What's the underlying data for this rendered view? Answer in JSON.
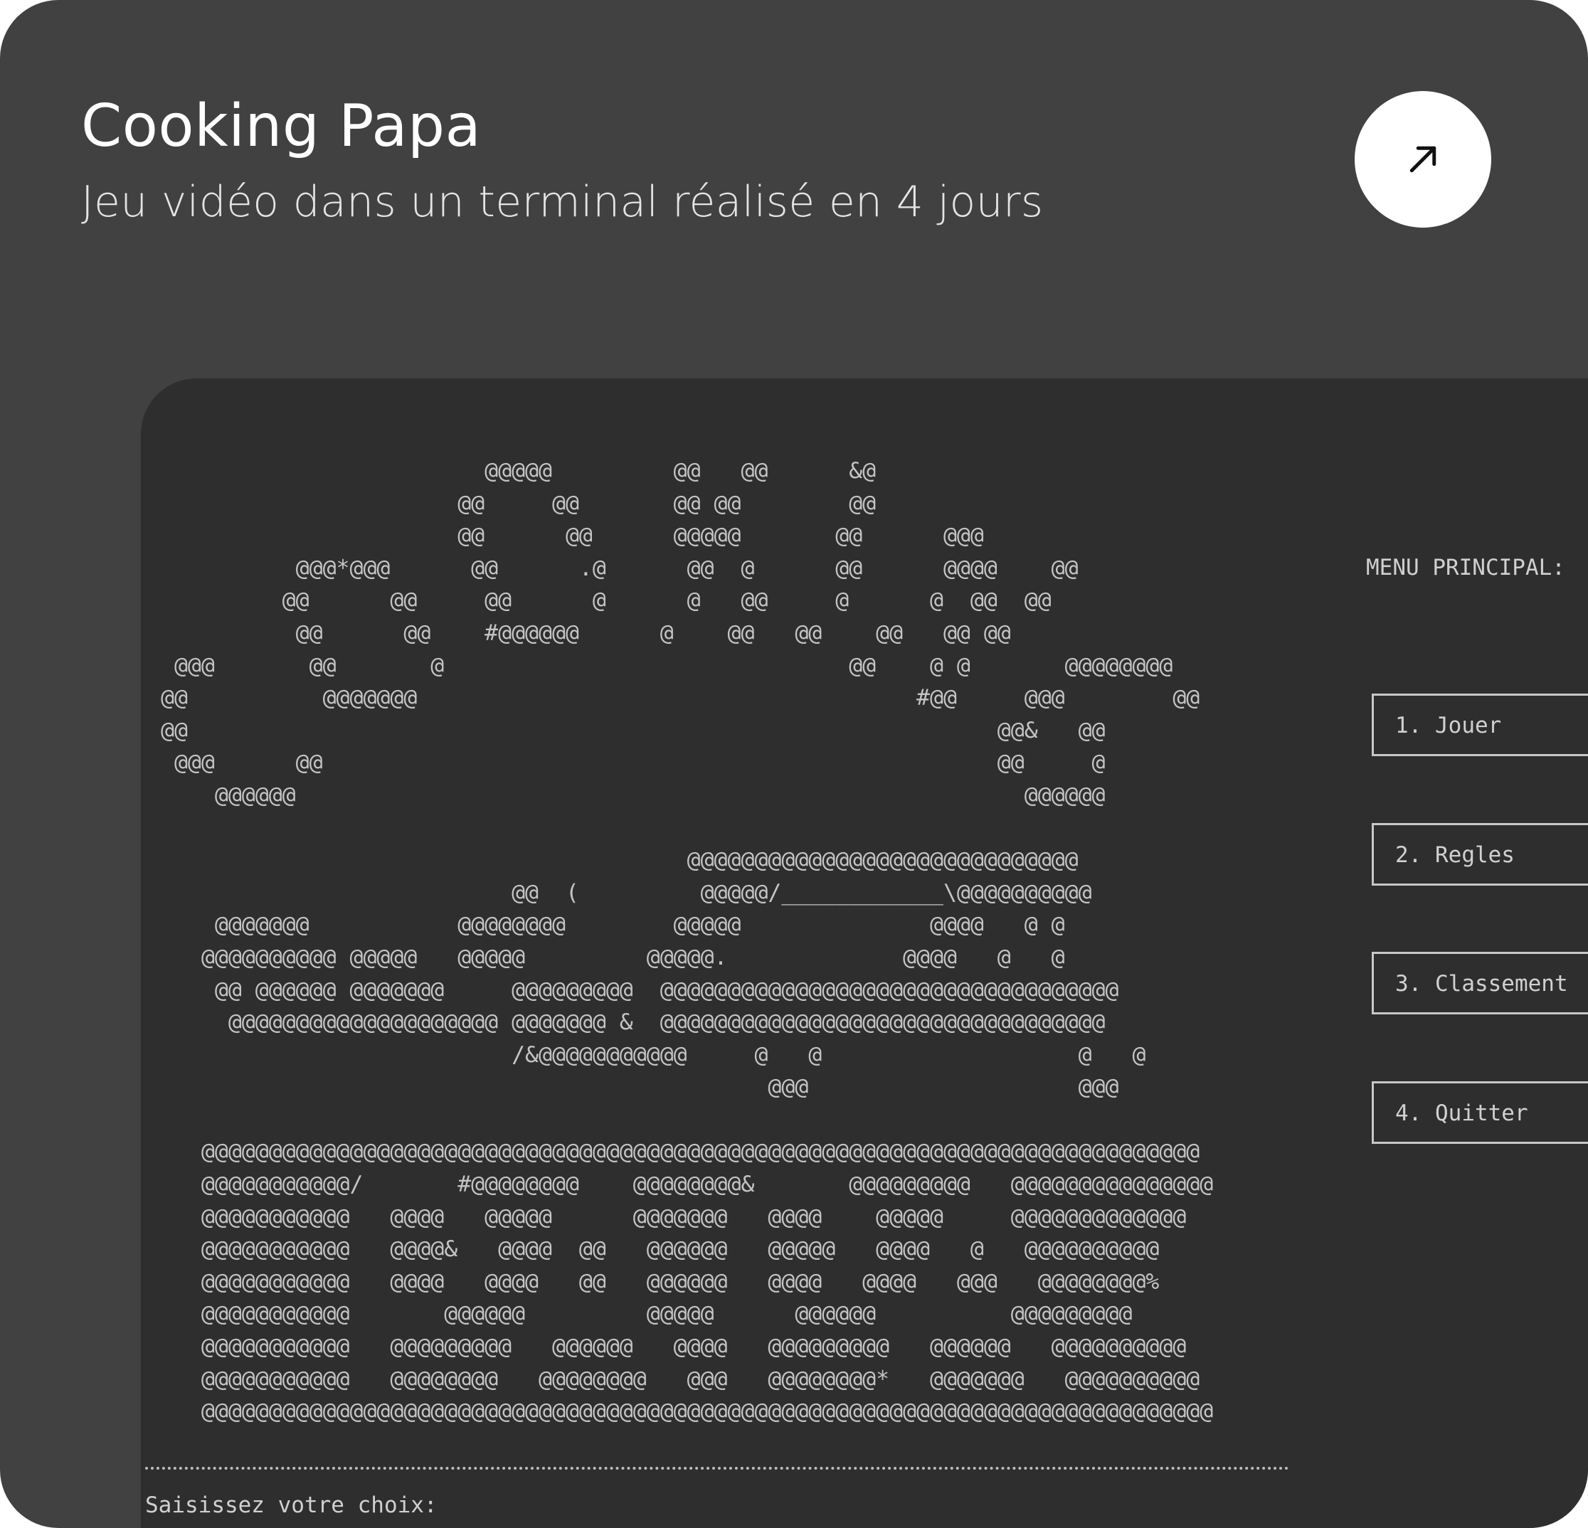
{
  "card": {
    "title": "Cooking Papa",
    "subtitle": "Jeu vidéo dans un terminal réalisé en 4 jours",
    "open_icon": "arrow-up-right-icon",
    "background_color": "#414141"
  },
  "terminal": {
    "background_color": "#2e2e2e",
    "ascii_art": "                        @@@@@         @@   @@      &@\n                      @@     @@       @@ @@        @@\n                      @@      @@      @@@@@       @@      @@@\n          @@@*@@@      @@      .@      @@  @      @@      @@@@    @@\n         @@      @@     @@      @      @   @@     @      @  @@  @@\n          @@      @@    #@@@@@@      @    @@   @@    @@   @@ @@\n @@@       @@       @                              @@    @ @       @@@@@@@@\n@@          @@@@@@@                                     #@@     @@@        @@\n@@                                                            @@&   @@\n @@@      @@                                                  @@     @\n    @@@@@@                                                      @@@@@@\n\n                                       @@@@@@@@@@@@@@@@@@@@@@@@@@@@@\n                          @@  (         @@@@@/____________\\@@@@@@@@@@\n    @@@@@@@           @@@@@@@@        @@@@@              @@@@   @ @\n   @@@@@@@@@@ @@@@@   @@@@@         @@@@@.             @@@@   @   @\n    @@ @@@@@@ @@@@@@@     @@@@@@@@@  @@@@@@@@@@@@@@@@@@@@@@@@@@@@@@@@@@\n     @@@@@@@@@@@@@@@@@@@@ @@@@@@@ &  @@@@@@@@@@@@@@@@@@@@@@@@@@@@@@@@@\n                          /&@@@@@@@@@@@     @   @                   @   @\n                                             @@@                    @@@\n\n   @@@@@@@@@@@@@@@@@@@@@@@@@@@@@@@@@@@@@@@@@@@@@@@@@@@@@@@@@@@@@@@@@@@@@@@@@@\n   @@@@@@@@@@@/       #@@@@@@@@    @@@@@@@@&       @@@@@@@@@   @@@@@@@@@@@@@@@\n   @@@@@@@@@@@   @@@@   @@@@@      @@@@@@@   @@@@    @@@@@     @@@@@@@@@@@@@\n   @@@@@@@@@@@   @@@@&   @@@@  @@   @@@@@@   @@@@@   @@@@   @   @@@@@@@@@@\n   @@@@@@@@@@@   @@@@   @@@@   @@   @@@@@@   @@@@   @@@@   @@@   @@@@@@@@%\n   @@@@@@@@@@@       @@@@@@         @@@@@      @@@@@@          @@@@@@@@@\n   @@@@@@@@@@@   @@@@@@@@@   @@@@@@   @@@@   @@@@@@@@@   @@@@@@   @@@@@@@@@@\n   @@@@@@@@@@@   @@@@@@@@   @@@@@@@@   @@@   @@@@@@@@*   @@@@@@@   @@@@@@@@@@\n   @@@@@@@@@@@@@@@@@@@@@@@@@@@@@@@@@@@@@@@@@@@@@@@@@@@@@@@@@@@@@@@@@@@@@@@@@@@",
    "menu_title": "MENU PRINCIPAL:",
    "menu_items": [
      {
        "label": "1. Jouer"
      },
      {
        "label": "2. Regles"
      },
      {
        "label": "3. Classement"
      },
      {
        "label": "4. Quitter"
      }
    ],
    "prompt_label": "Saisissez votre choix:",
    "prompt_value": ""
  }
}
